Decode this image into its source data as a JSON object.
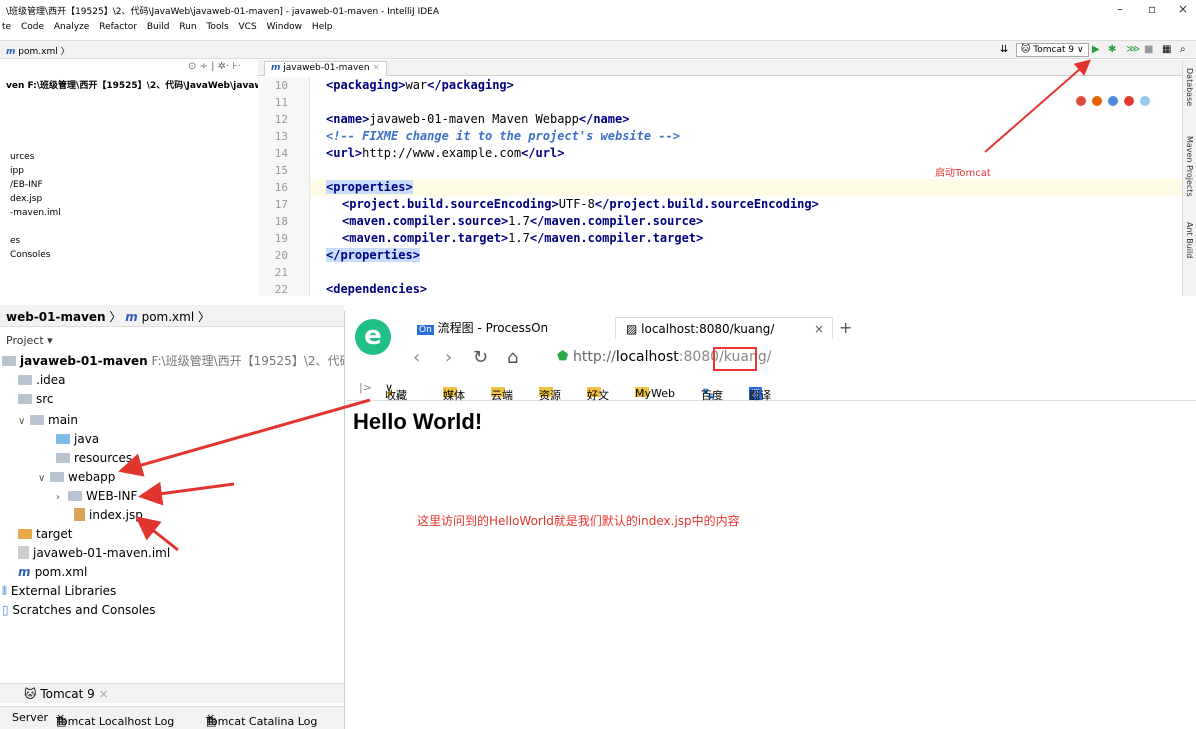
{
  "top_ide": {
    "title": "\\班级管理\\西开【19525】\\2、代码\\JavaWeb\\javaweb-01-maven] - javaweb-01-maven - IntelliJ IDEA",
    "window_buttons": [
      "–",
      "▫",
      "×"
    ],
    "menu": [
      "te",
      "Code",
      "Analyze",
      "Refactor",
      "Build",
      "Run",
      "Tools",
      "VCS",
      "Window",
      "Help"
    ],
    "breadcrumb_file": "pom.xml",
    "run_config": "Tomcat 9",
    "project_header_icons": "⊙ ÷ | ✲· ⊦·",
    "project_root": "ven F:\\班级管理\\西开【19525】\\2、代码\\JavaWeb\\javaweb-01-m",
    "project_items": [
      "urces",
      "ipp",
      "/EB-INF",
      "dex.jsp",
      "-maven.iml",
      "es",
      "Consoles"
    ],
    "editor_tab": "javaweb-01-maven",
    "line_numbers": [
      "10",
      "11",
      "12",
      "13",
      "14",
      "15",
      "16",
      "17",
      "18",
      "19",
      "20",
      "21",
      "22"
    ],
    "code": {
      "l10_open": "<packaging>",
      "l10_text": "war",
      "l10_close": "</packaging>",
      "l12_open": "<name>",
      "l12_text": "javaweb-01-maven Maven Webapp",
      "l12_close": "</name>",
      "l13_comment": "<!-- FIXME change it to the project's website -->",
      "l14_open": "<url>",
      "l14_text": "http://www.example.com",
      "l14_close": "</url>",
      "l16": "<properties>",
      "l17_open": "<project.build.sourceEncoding>",
      "l17_text": "UTF-8",
      "l17_close": "</project.build.sourceEncoding>",
      "l18_open": "<maven.compiler.source>",
      "l18_text": "1.7",
      "l18_close": "</maven.compiler.source>",
      "l19_open": "<maven.compiler.target>",
      "l19_text": "1.7",
      "l19_close": "</maven.compiler.target>",
      "l20": "</properties>",
      "l22": "<dependencies>"
    },
    "right_strip": [
      "Database",
      "Maven Projects",
      "Ant Build"
    ],
    "annotation_tomcat": "启动Tomcat"
  },
  "bottom_ide": {
    "breadcrumb_project": "web-01-maven",
    "breadcrumb_file": "pom.xml",
    "project_dropdown": "Project ▾",
    "root_name": "javaweb-01-maven",
    "root_path": "F:\\班级管理\\西开【19525】\\2、代码\\JavaW",
    "tree": {
      "idea": ".idea",
      "src": "src",
      "main": "main",
      "java": "java",
      "resources": "resources",
      "webapp": "webapp",
      "webinf": "WEB-INF",
      "indexjsp": "index.jsp",
      "target": "target",
      "iml": "javaweb-01-maven.iml",
      "pom": "pom.xml",
      "extlibs": "External Libraries",
      "scratches": "Scratches and Consoles"
    },
    "services_tab": "Tomcat 9",
    "services_tabs": [
      "Server",
      "Tomcat Localhost Log",
      "Tomcat Catalina Log"
    ]
  },
  "browser": {
    "logo": "e",
    "tab1": "流程图 - ProcessOn",
    "tab1_icon": "On",
    "tab2": "localhost:8080/kuang/",
    "new_tab": "+",
    "url_prefix": "http://",
    "url_host": "localhost",
    "url_port": ":8080",
    "url_path": "/kuang/",
    "bookmarks": [
      "收藏",
      "媒体",
      "云端",
      "资源",
      "好文",
      "MyWeb",
      "百度",
      "翻译"
    ],
    "page_heading": "Hello World!",
    "annotation": "这里访问到的HelloWorld就是我们默认的index.jsp中的内容"
  },
  "colors": {
    "annotation_red": "#e3352f",
    "xml_tag": "#000080",
    "comment": "#3d70c9",
    "selection": "#c7ddfc"
  }
}
